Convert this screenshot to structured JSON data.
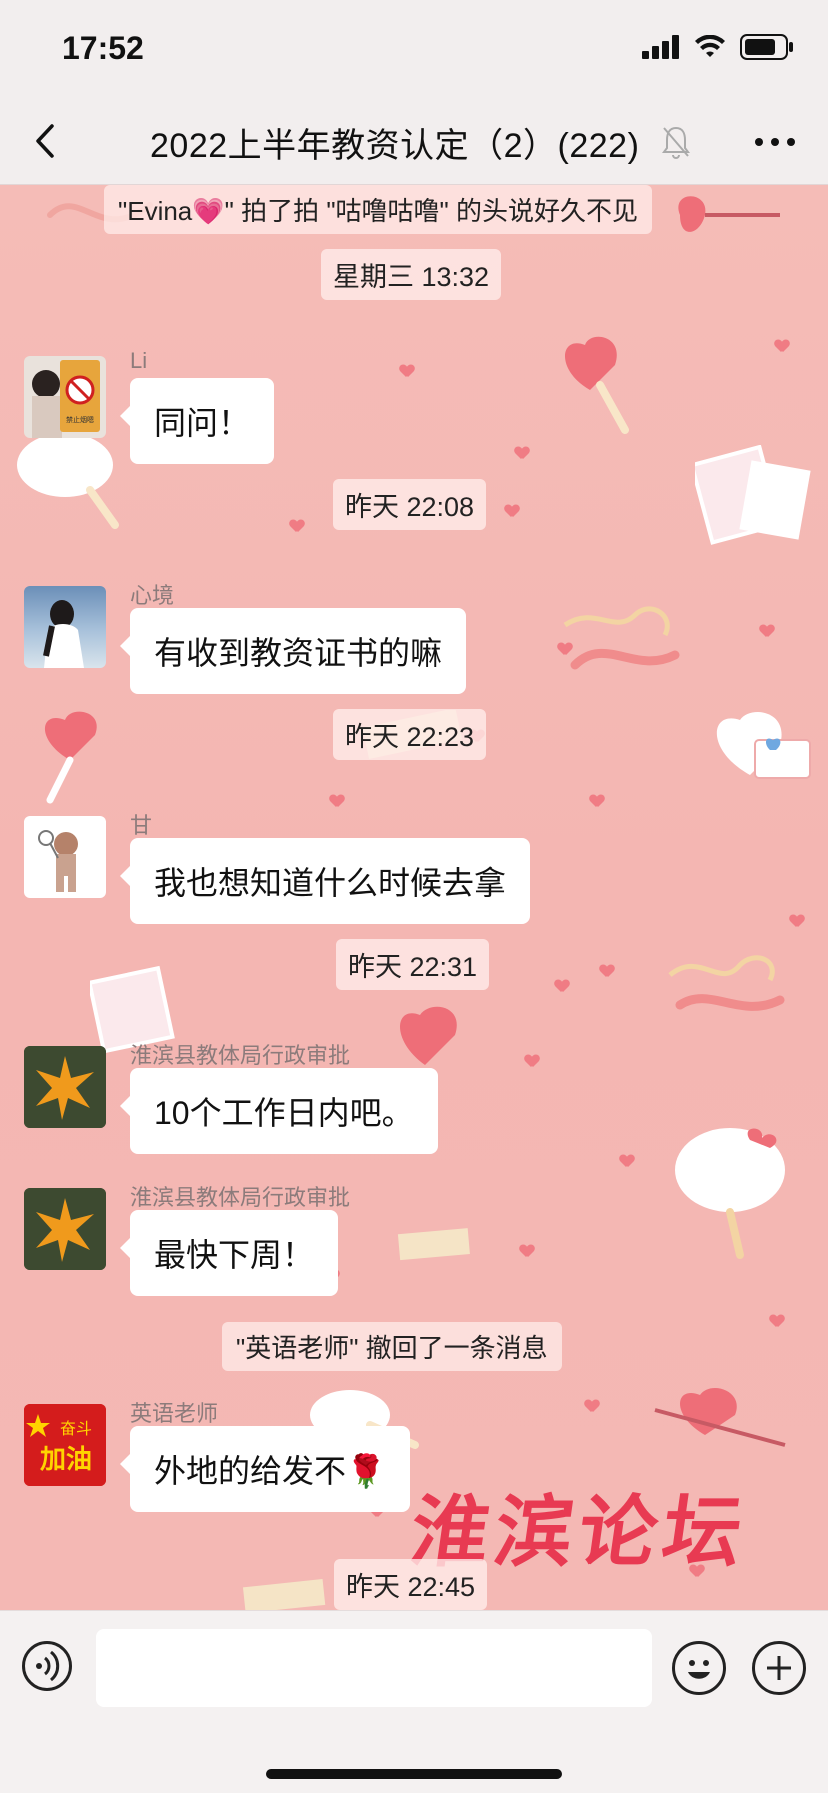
{
  "status": {
    "time": "17:52"
  },
  "nav": {
    "title": "2022上半年教资认定（2）(222)"
  },
  "system_top": "\"Evina💗\" 拍了拍 \"咕噜咕噜\" 的头说好久不见",
  "times": [
    "星期三 13:32",
    "昨天 22:08",
    "昨天 22:23",
    "昨天 22:31",
    "昨天 22:45"
  ],
  "messages": [
    {
      "sender": "Li",
      "text": "同问！"
    },
    {
      "sender": "心境",
      "text": "有收到教资证书的嘛"
    },
    {
      "sender": "甘",
      "text": "我也想知道什么时候去拿"
    },
    {
      "sender": "淮滨县教体局行政审批",
      "text": "10个工作日内吧。"
    },
    {
      "sender": "淮滨县教体局行政审批",
      "text": "最快下周！"
    },
    {
      "sender": "英语老师",
      "text": "外地的给发不🌹"
    }
  ],
  "recall_notice": "\"英语老师\" 撤回了一条消息",
  "watermark": "淮滨论坛",
  "avatars": {
    "li_badge": "禁止烟嗯",
    "english_badge_top": "奋斗",
    "english_badge_bottom": "加油"
  },
  "colors": {
    "background": "#f4b8b4",
    "bubble": "#ffffff",
    "watermark": "#e8304a"
  }
}
